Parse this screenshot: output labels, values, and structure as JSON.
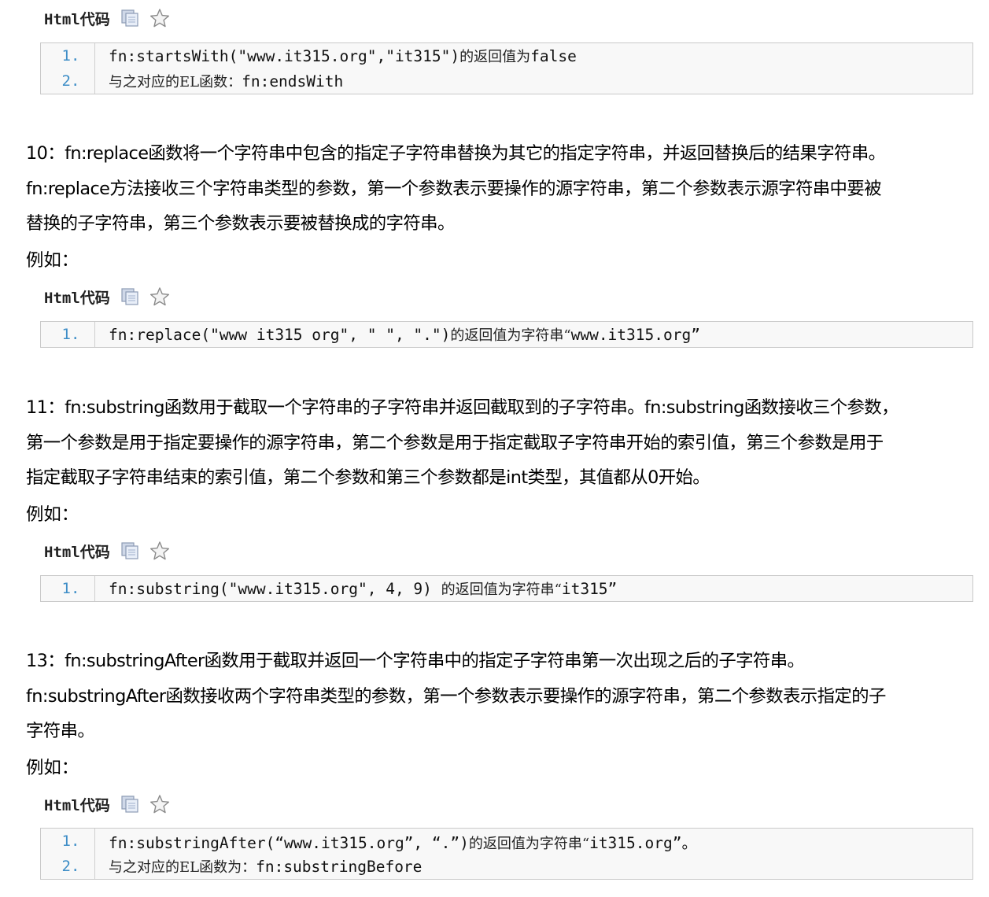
{
  "header_label": "Html代码",
  "blocks": [
    {
      "lines": [
        {
          "num": "1.",
          "code": "fn:startsWith(\"www.it315.org\",\"it315\")",
          "cn": "的返回值为",
          "tail": "false"
        },
        {
          "num": "2.",
          "code": "",
          "cn": "与之对应的EL函数：",
          "tail": "fn:endsWith"
        }
      ]
    },
    {
      "lines": [
        {
          "num": "1.",
          "code": "fn:replace(\"www it315 org\", \" \", \".\")",
          "cn": "的返回值为字符串“",
          "tail": "www.it315.org”"
        }
      ]
    },
    {
      "lines": [
        {
          "num": "1.",
          "code": "fn:substring(\"www.it315.org\", 4, 9) ",
          "cn": "的返回值为字符串“",
          "tail": "it315”"
        }
      ]
    },
    {
      "lines": [
        {
          "num": "1.",
          "code": "fn:substringAfter(“www.it315.org”, “.”)",
          "cn": "的返回值为字符串“",
          "tail": "it315.org”。"
        },
        {
          "num": "2.",
          "code": "",
          "cn": "与之对应的EL函数为：",
          "tail": "fn:substringBefore"
        }
      ]
    }
  ],
  "paragraphs": [
    {
      "lines": [
        "10：fn:replace函数将一个字符串中包含的指定子字符串替换为其它的指定字符串，并返回替换后的结果字符串。",
        "fn:replace方法接收三个字符串类型的参数，第一个参数表示要操作的源字符串，第二个参数表示源字符串中要被",
        "替换的子字符串，第三个参数表示要被替换成的字符串。"
      ],
      "example": "例如："
    },
    {
      "lines": [
        "11：fn:substring函数用于截取一个字符串的子字符串并返回截取到的子字符串。fn:substring函数接收三个参数，",
        "第一个参数是用于指定要操作的源字符串，第二个参数是用于指定截取子字符串开始的索引值，第三个参数是用于",
        "指定截取子字符串结束的索引值，第二个参数和第三个参数都是int类型，其值都从0开始。"
      ],
      "example": "例如："
    },
    {
      "lines": [
        "13：fn:substringAfter函数用于截取并返回一个字符串中的指定子字符串第一次出现之后的子字符串。",
        "fn:substringAfter函数接收两个字符串类型的参数，第一个参数表示要操作的源字符串，第二个参数表示指定的子",
        "字符串。"
      ],
      "example": "例如："
    }
  ],
  "icons": {
    "copy": "copy-icon",
    "favorite": "star-icon"
  }
}
